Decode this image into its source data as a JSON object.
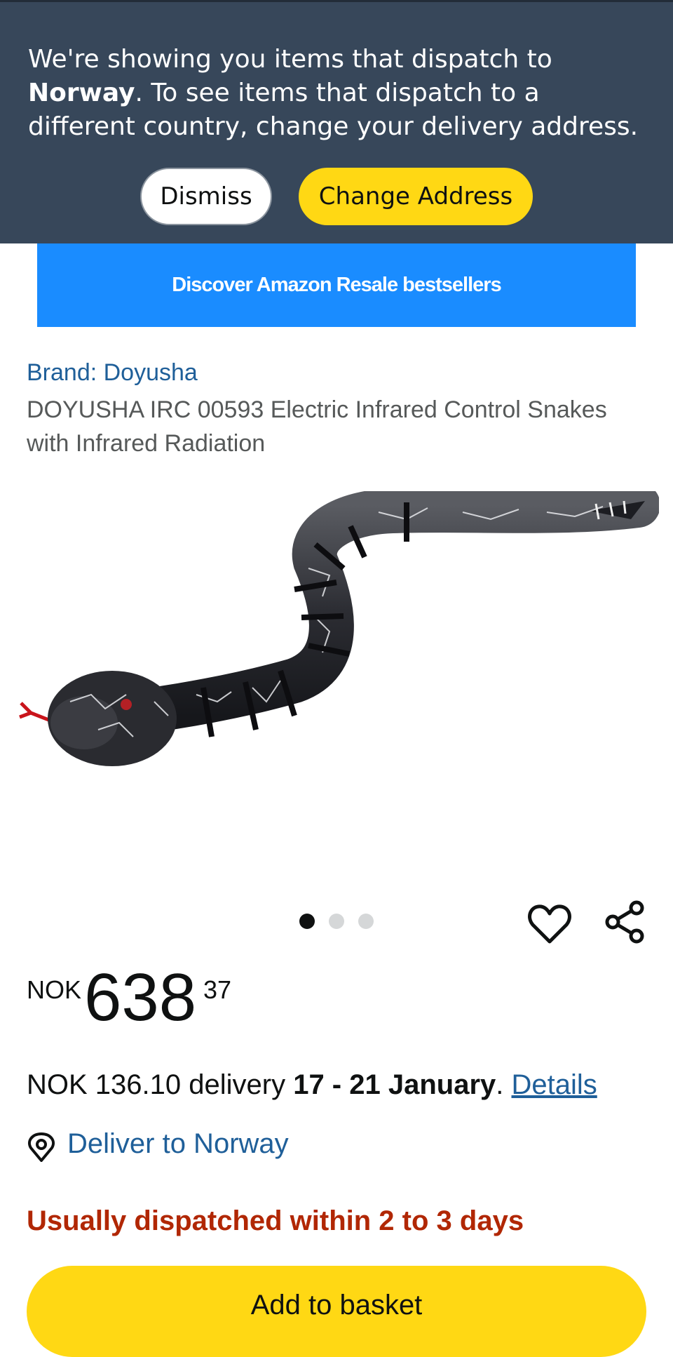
{
  "banner": {
    "text_prefix": "We're showing you items that dispatch to ",
    "country": "Norway",
    "text_suffix": ". To see items that dispatch to a different country, change your delivery address.",
    "dismiss_label": "Dismiss",
    "change_address_label": "Change Address"
  },
  "promo": {
    "label": "Discover Amazon Resale bestsellers"
  },
  "product": {
    "brand": "Brand: Doyusha",
    "title": "DOYUSHA IRC 00593 Electric Infrared Control Snakes with Infrared Radiation",
    "image_icon": "snake-product-image",
    "image_dots": 3,
    "active_dot": 0
  },
  "price": {
    "currency": "NOK",
    "whole": "638",
    "fraction": "37"
  },
  "delivery": {
    "prefix": "NOK 136.10 delivery ",
    "dates": "17 - 21 January",
    "separator": ". ",
    "details_label": "Details"
  },
  "location": {
    "icon": "location-pin-icon",
    "label": "Deliver to Norway"
  },
  "availability": "Usually dispatched within 2 to 3 days",
  "actions": {
    "add_to_basket_label": "Add to basket",
    "wishlist_icon": "heart-icon",
    "share_icon": "share-icon"
  },
  "colors": {
    "banner_bg": "#37475a",
    "button_yellow": "#ffd814",
    "promo_blue": "#1a8cff",
    "link_blue": "#1f5f99",
    "availability_red": "#b12704"
  }
}
